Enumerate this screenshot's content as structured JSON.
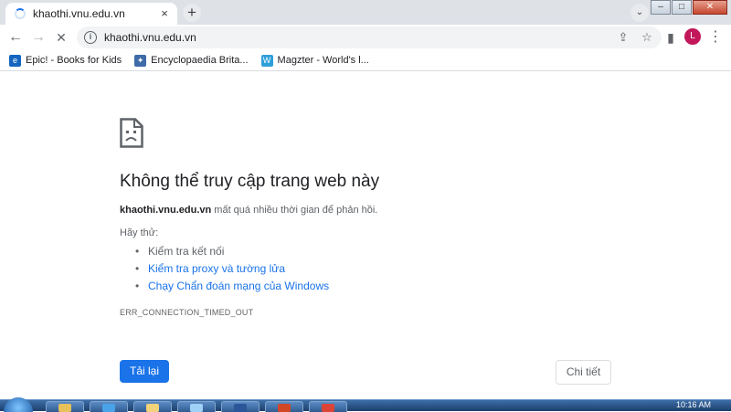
{
  "window": {
    "tab_title": "khaothi.vnu.edu.vn",
    "tab_close": "×",
    "new_tab": "+",
    "tab_search": "⌄",
    "min": "–",
    "max": "□",
    "close": "✕"
  },
  "toolbar": {
    "back": "←",
    "forward": "→",
    "stop": "✕",
    "url": "khaothi.vnu.edu.vn",
    "share_icon": "⇪",
    "star_icon": "☆",
    "sidepanel_icon": "▮",
    "avatar_letter": "L",
    "menu_icon": "⋮"
  },
  "bookmarks": [
    {
      "label": "Epic! - Books for Kids",
      "icon": "e",
      "color": "#1565c0"
    },
    {
      "label": "Encyclopaedia Brita...",
      "icon": "✦",
      "color": "#3f6ba8"
    },
    {
      "label": "Magzter - World's l...",
      "icon": "W",
      "color": "#2e9fd8"
    }
  ],
  "error": {
    "title": "Không thể truy cập trang web này",
    "host": "khaothi.vnu.edu.vn",
    "desc_rest": " mất quá nhiều thời gian để phản hồi.",
    "try_label": "Hãy thử:",
    "suggestions": [
      {
        "text": "Kiểm tra kết nối",
        "link": false
      },
      {
        "text": "Kiểm tra proxy và tường lửa",
        "link": true
      },
      {
        "text": "Chạy Chẩn đoán mạng của Windows",
        "link": true
      }
    ],
    "code": "ERR_CONNECTION_TIMED_OUT",
    "reload_label": "Tải lại",
    "details_label": "Chi tiết"
  },
  "taskbar": {
    "clock": "10:16 AM",
    "items": [
      {
        "name": "explorer",
        "color": "#e8c15a"
      },
      {
        "name": "ie",
        "color": "#4aa3e8"
      },
      {
        "name": "files",
        "color": "#f3d37a"
      },
      {
        "name": "media",
        "color": "#9fd0f5"
      },
      {
        "name": "word",
        "color": "#2b579a"
      },
      {
        "name": "powerpoint",
        "color": "#d24726"
      },
      {
        "name": "chrome",
        "color": "#db4437"
      }
    ]
  }
}
